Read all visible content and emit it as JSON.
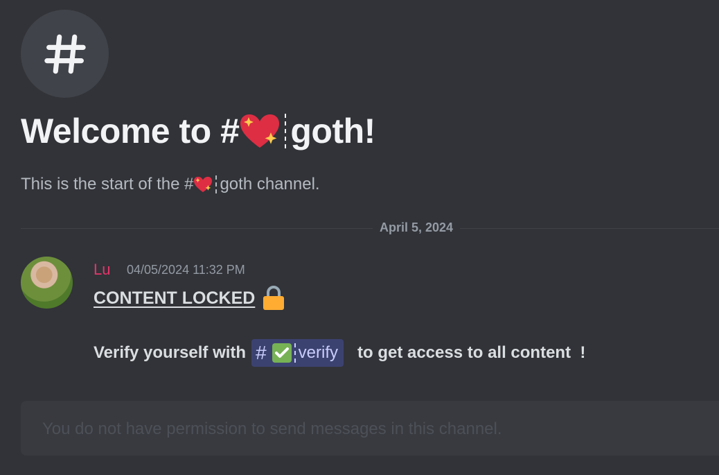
{
  "channel": {
    "icon": "hash-icon",
    "welcome_prefix": "Welcome to #",
    "emoji": "sparkling-heart-emoji",
    "name_suffix": "goth!",
    "sub_prefix": "This is the start of the #",
    "sub_suffix": "goth channel."
  },
  "divider": {
    "date": "April 5, 2024"
  },
  "message": {
    "author": "Lu",
    "author_color": "#e8346a",
    "timestamp": "04/05/2024 11:32 PM",
    "heading": "CONTENT LOCKED",
    "heading_emoji": "lock-emoji",
    "line_prefix": "Verify yourself with",
    "mention": {
      "hash": "#",
      "emoji": "check-mark-emoji",
      "name": "verify"
    },
    "line_suffix": "to get access to all content  !"
  },
  "composer": {
    "placeholder": "You do not have permission to send messages in this channel."
  },
  "colors": {
    "background": "#313338",
    "mention_bg": "#3c4270"
  }
}
